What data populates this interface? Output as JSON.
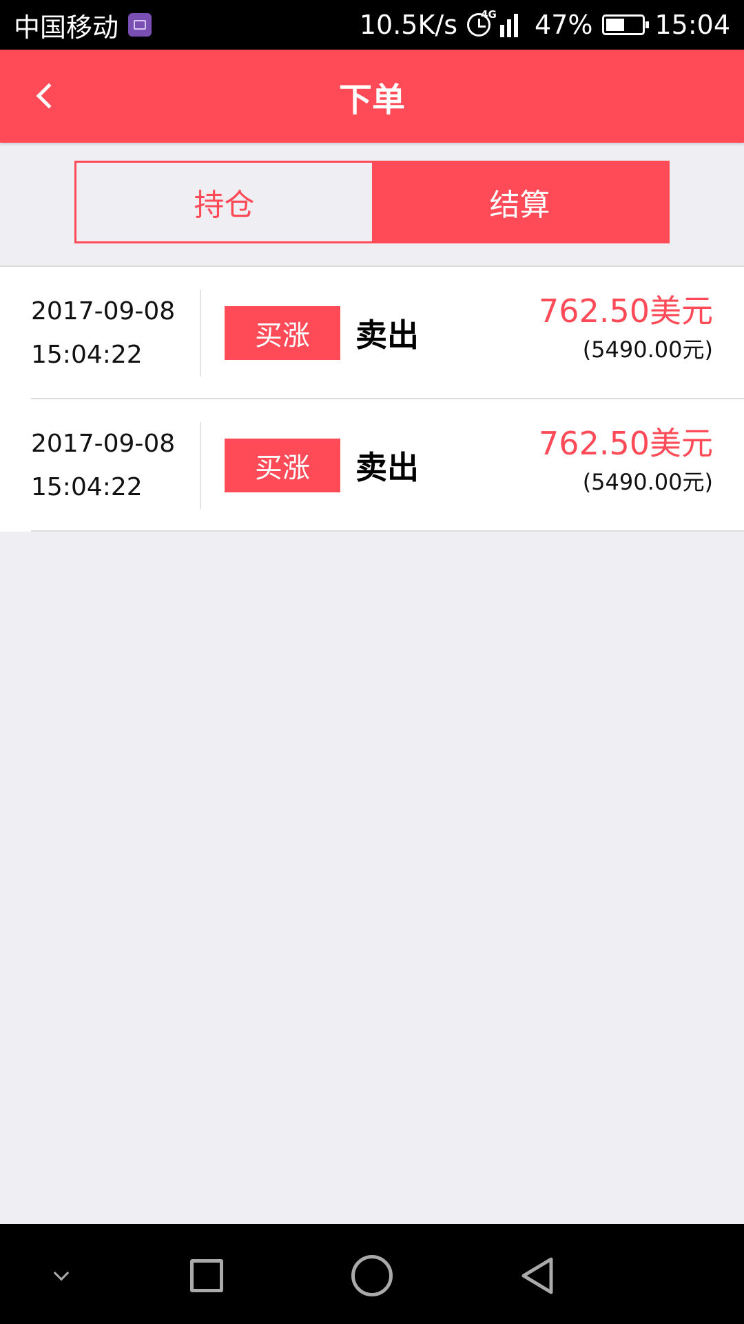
{
  "status_bar": {
    "carrier": "中国移动",
    "net_speed": "10.5K/s",
    "net_type": "4G",
    "battery": "47%",
    "time": "15:04"
  },
  "app_bar": {
    "title": "下单"
  },
  "tabs": [
    {
      "label": "持仓",
      "active": false
    },
    {
      "label": "结算",
      "active": true
    }
  ],
  "orders": [
    {
      "date": "2017-09-08",
      "time": "15:04:22",
      "tag": "买涨",
      "action": "卖出",
      "amount_usd": "762.50美元",
      "amount_cny": "(5490.00元)"
    },
    {
      "date": "2017-09-08",
      "time": "15:04:22",
      "tag": "买涨",
      "action": "卖出",
      "amount_usd": "762.50美元",
      "amount_cny": "(5490.00元)"
    }
  ],
  "colors": {
    "accent": "#fe4b57",
    "background": "#efeef3"
  }
}
